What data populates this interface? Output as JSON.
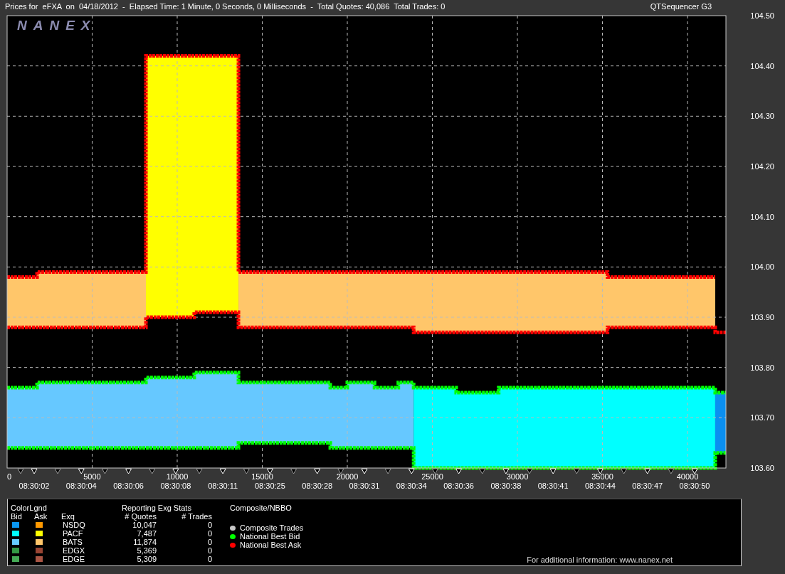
{
  "header": {
    "title": "Prices for  eFXA  on  04/18/2012  -  Elapsed Time: 1 Minute, 0 Seconds, 0 Milliseconds  -  Total Quotes: 40,086  Total Trades: 0",
    "product": "QTSequencer G3"
  },
  "chart": {
    "logo": "NANEX",
    "time_labels": [
      "08:30:02",
      "08:30:04",
      "08:30:06",
      "08:30:08",
      "08:30:11",
      "08:30:25",
      "08:30:28",
      "08:30:31",
      "08:30:34",
      "08:30:36",
      "08:30:38",
      "08:30:41",
      "08:30:44",
      "08:30:47",
      "08:30:50"
    ],
    "chart_data": {
      "type": "area",
      "grid": true,
      "x": [
        0,
        1760,
        1760,
        8160,
        8160,
        11000,
        11000,
        13600,
        13600,
        19000,
        19000,
        20000,
        20000,
        21600,
        21600,
        23000,
        23000,
        23900,
        23900,
        26400,
        26400,
        28900,
        28900,
        35300,
        35300,
        41630,
        41630,
        42260
      ],
      "series": [
        {
          "color": "#ffc66a",
          "values": [
            103.98,
            103.98,
            103.99,
            103.99,
            null,
            null,
            null,
            null,
            103.99,
            103.99,
            103.99,
            103.99,
            103.99,
            103.99,
            103.99,
            103.99,
            103.99,
            103.99,
            103.99,
            103.99,
            103.99,
            103.99,
            103.99,
            103.99,
            103.98,
            103.98,
            null,
            null
          ]
        },
        {
          "color": "#ffff00",
          "values": [
            null,
            null,
            null,
            null,
            104.42,
            104.42,
            104.42,
            104.42,
            null,
            null,
            null,
            null,
            null,
            null,
            null,
            null,
            null,
            null,
            null,
            null,
            null,
            null,
            null,
            null,
            null,
            null,
            null,
            null
          ]
        },
        {
          "color": "#66c8ff",
          "values": [
            103.76,
            103.76,
            103.77,
            103.77,
            103.78,
            103.78,
            103.79,
            103.79,
            103.77,
            103.77,
            103.76,
            103.76,
            103.77,
            103.77,
            103.76,
            103.76,
            103.77,
            103.77,
            null,
            null,
            null,
            null,
            null,
            null,
            null,
            null,
            null,
            null
          ]
        },
        {
          "color": "#00ffff",
          "values": [
            null,
            null,
            null,
            null,
            null,
            null,
            null,
            null,
            null,
            null,
            null,
            null,
            null,
            null,
            null,
            null,
            null,
            null,
            103.76,
            103.76,
            103.75,
            103.75,
            103.76,
            103.76,
            103.76,
            103.76,
            null,
            null
          ]
        },
        {
          "color": "#0a8ff0",
          "values": [
            null,
            null,
            null,
            null,
            null,
            null,
            null,
            null,
            null,
            null,
            null,
            null,
            null,
            null,
            null,
            null,
            null,
            null,
            null,
            null,
            null,
            null,
            null,
            null,
            null,
            null,
            103.75,
            103.75
          ]
        },
        {
          "type": "line",
          "color": "#00ff00",
          "line_style": "dotted",
          "values": [
            103.64,
            103.64,
            103.64,
            103.64,
            103.64,
            103.64,
            103.64,
            103.64,
            103.65,
            103.65,
            103.64,
            103.64,
            103.64,
            103.64,
            103.64,
            103.64,
            103.64,
            103.64,
            103.6,
            103.6,
            103.6,
            103.6,
            103.6,
            103.6,
            103.6,
            103.6,
            103.63,
            103.63
          ]
        },
        {
          "type": "line",
          "name": "National Best Bid",
          "color": "#00ff00",
          "line_style": "dotted",
          "values": [
            103.76,
            103.76,
            103.77,
            103.77,
            103.78,
            103.78,
            103.79,
            103.79,
            103.77,
            103.77,
            103.76,
            103.76,
            103.77,
            103.77,
            103.76,
            103.76,
            103.77,
            103.77,
            103.76,
            103.76,
            103.75,
            103.75,
            103.76,
            103.76,
            103.76,
            103.76,
            103.75,
            103.75
          ]
        },
        {
          "type": "line",
          "name": "National Best Ask",
          "color": "#ff0000",
          "line_style": "dotted",
          "values": [
            103.88,
            103.88,
            103.88,
            103.88,
            103.9,
            103.9,
            103.91,
            103.91,
            103.88,
            103.88,
            103.88,
            103.88,
            103.88,
            103.88,
            103.88,
            103.88,
            103.88,
            103.88,
            103.87,
            103.87,
            103.87,
            103.87,
            103.87,
            103.87,
            103.88,
            103.88,
            103.87,
            103.87
          ]
        },
        {
          "type": "line",
          "color": "#ff0000",
          "line_style": "dotted",
          "values": [
            103.98,
            103.98,
            103.99,
            103.99,
            104.42,
            104.42,
            104.42,
            104.42,
            103.99,
            103.99,
            103.99,
            103.99,
            103.99,
            103.99,
            103.99,
            103.99,
            103.99,
            103.99,
            103.99,
            103.99,
            103.99,
            103.99,
            103.99,
            103.99,
            103.98,
            103.98,
            null,
            null
          ]
        }
      ],
      "xlim": [
        0,
        42260
      ],
      "ylim": [
        103.6,
        104.5
      ],
      "xticks": [
        0,
        5000,
        10000,
        15000,
        20000,
        25000,
        30000,
        35000,
        40000
      ],
      "yticks": [
        {
          "value": 103.6,
          "label": "103.60"
        },
        {
          "value": 103.7,
          "label": "103.70"
        },
        {
          "value": 103.8,
          "label": "103.80"
        },
        {
          "value": 103.9,
          "label": "103.90"
        },
        {
          "value": 104.0,
          "label": "104.00"
        },
        {
          "value": 104.1,
          "label": "104.10"
        },
        {
          "value": 104.2,
          "label": "104.20"
        },
        {
          "value": 104.3,
          "label": "104.30"
        },
        {
          "value": 104.4,
          "label": "104.40"
        },
        {
          "value": 104.5,
          "label": "104.50"
        }
      ]
    }
  },
  "legend": {
    "color_title": "ColorLgnd",
    "stats_title": "Reporting Exg Stats",
    "composite_title": "Composite/NBBO",
    "columns": [
      "Bid",
      "Ask",
      "Exq",
      "# Quotes",
      "# Trades"
    ],
    "rows": [
      {
        "bid": {
          "color": "#0a96f0"
        },
        "ask": {
          "color": "#ff9900"
        },
        "exchange": "NSDQ",
        "quotes": "10,047",
        "trades": "0"
      },
      {
        "bid": {
          "color": "#00ffff"
        },
        "ask": {
          "color": "#ffff00"
        },
        "exchange": "PACF",
        "quotes": "7,487",
        "trades": "0"
      },
      {
        "bid": {
          "color": "#66ccff"
        },
        "ask": {
          "color": "#ffc66a"
        },
        "exchange": "BATS",
        "quotes": "11,874",
        "trades": "0"
      },
      {
        "bid": {
          "color": "#339944"
        },
        "ask": {
          "color": "#994433"
        },
        "exchange": "EDGX",
        "quotes": "5,369",
        "trades": "0"
      },
      {
        "bid": {
          "color": "#44aa55"
        },
        "ask": {
          "color": "#aa5544"
        },
        "exchange": "EDGE",
        "quotes": "5,309",
        "trades": "0"
      }
    ],
    "composite_trades": {
      "label": "Composite Trades",
      "color": "#c8c8c8"
    },
    "footer": "For additional information: www.nanex.net"
  }
}
